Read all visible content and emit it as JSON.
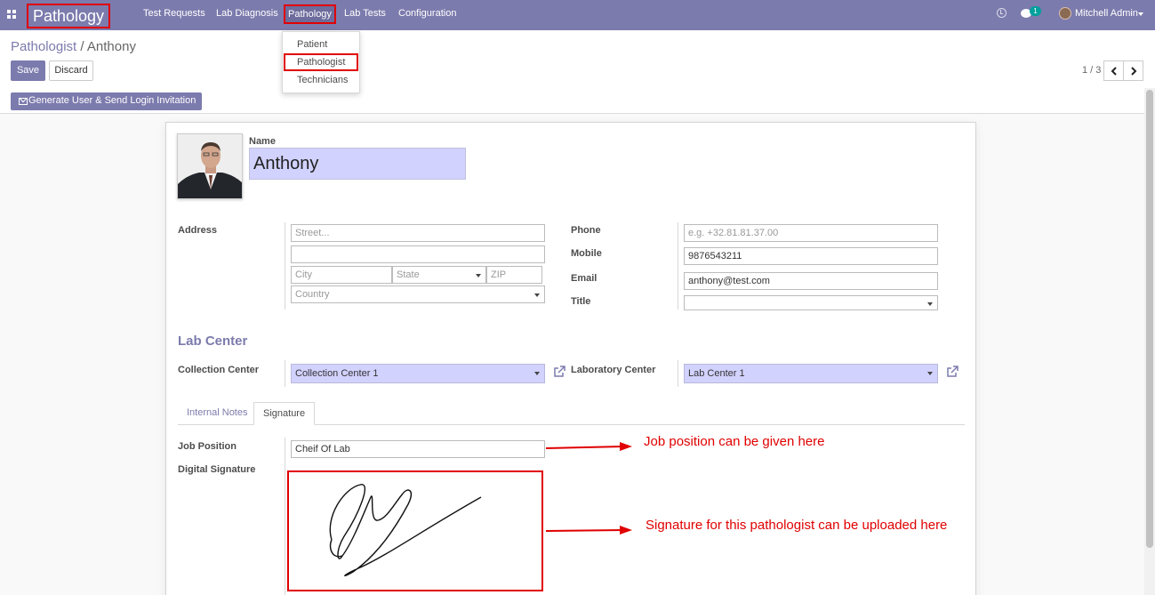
{
  "navbar": {
    "brand": "Pathology",
    "menu": [
      "Test Requests",
      "Lab Diagnosis",
      "Pathology",
      "Lab Tests",
      "Configuration"
    ],
    "active_menu": "Pathology",
    "chat_count": "1",
    "user_name": "Mitchell Admin",
    "icons": [
      "apps-icon",
      "clock-icon",
      "chat-icon",
      "avatar",
      "chevron-down-icon"
    ],
    "accent_color": "#7c7bad"
  },
  "dropdown": {
    "items": [
      "Patient",
      "Pathologist",
      "Technicians"
    ],
    "highlighted": "Pathologist"
  },
  "control_panel": {
    "breadcrumb_parent": "Pathologist",
    "breadcrumb_separator": "/",
    "breadcrumb_current": "Anthony",
    "save_label": "Save",
    "discard_label": "Discard",
    "pager": "1 / 3",
    "header_button": "Generate User & Send Login Invitation"
  },
  "form": {
    "name_label": "Name",
    "name_value": "Anthony",
    "address_label": "Address",
    "street_placeholder": "Street...",
    "street2_value": "",
    "city_placeholder": "City",
    "state_placeholder": "State",
    "zip_placeholder": "ZIP",
    "country_placeholder": "Country",
    "phone_label": "Phone",
    "phone_placeholder": "e.g. +32.81.81.37.00",
    "mobile_label": "Mobile",
    "mobile_value": "9876543211",
    "email_label": "Email",
    "email_value": "anthony@test.com",
    "title_label": "Title",
    "title_value": "",
    "lab_center_title": "Lab Center",
    "collection_center_label": "Collection Center",
    "collection_center_value": "Collection Center 1",
    "laboratory_center_label": "Laboratory Center",
    "laboratory_center_value": "Lab Center 1",
    "tabs": [
      "Internal Notes",
      "Signature"
    ],
    "active_tab": "Signature",
    "job_position_label": "Job Position",
    "job_position_value": "Cheif Of Lab",
    "digital_signature_label": "Digital Signature"
  },
  "annotations": {
    "job_position": "Job position can be given here",
    "signature": "Signature for this pathologist can be uploaded here",
    "highlight_color": "#e00000"
  }
}
